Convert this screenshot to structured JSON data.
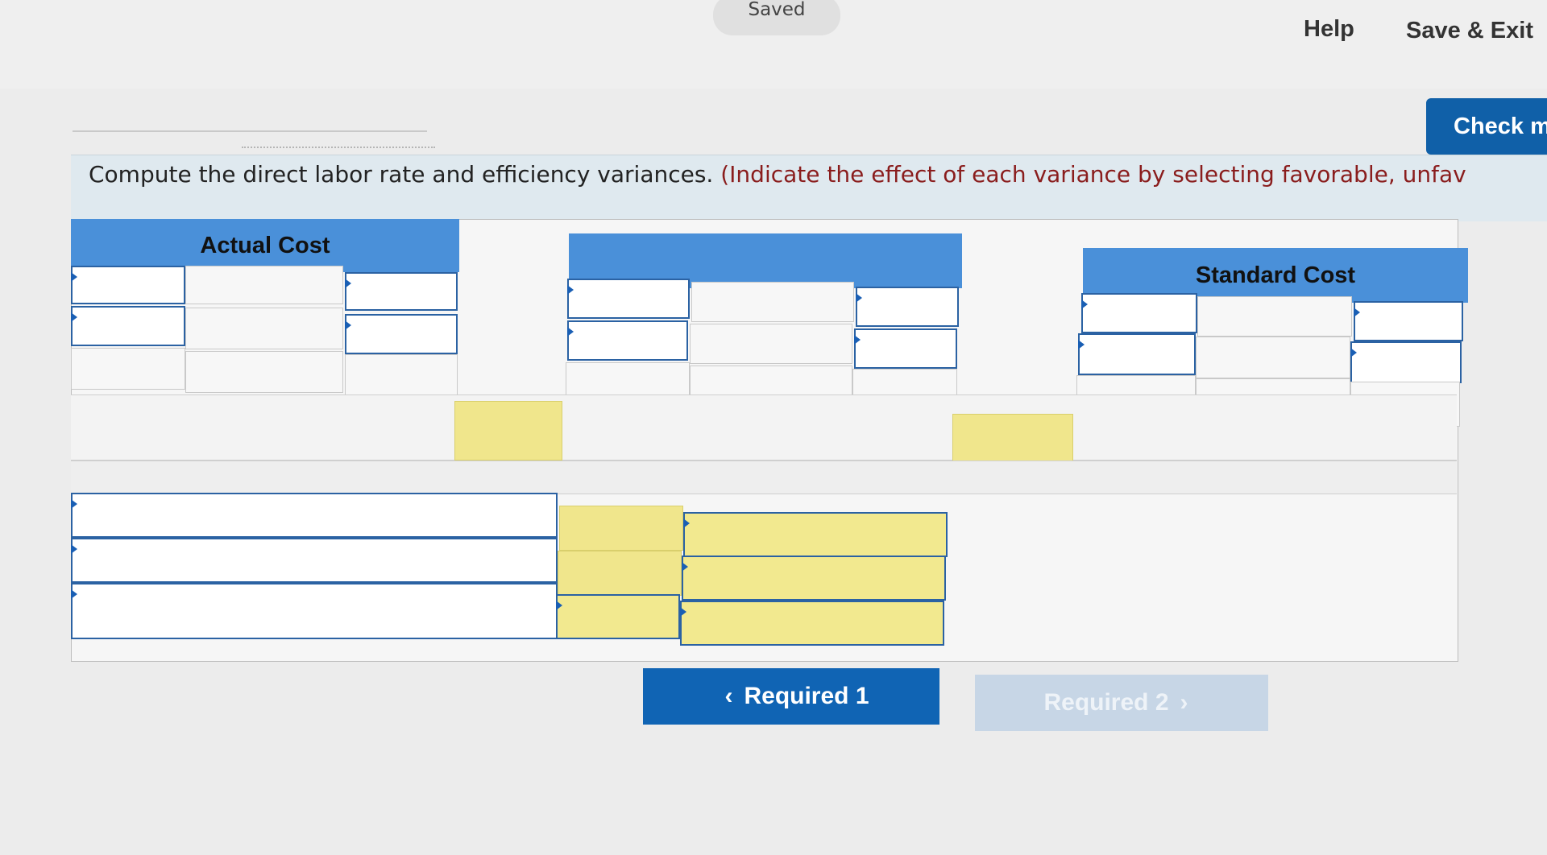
{
  "header": {
    "status": "Saved",
    "help": "Help",
    "save_exit": "Save & Exit",
    "check": "Check m"
  },
  "question": {
    "main": "Compute the direct labor rate and efficiency variances.",
    "paren": "(Indicate the effect of each variance by selecting favorable, unfav"
  },
  "worksheet": {
    "actual_header": "Actual Cost",
    "middle_header": "",
    "standard_header": "Standard Cost"
  },
  "nav": {
    "prev_label": "Required 1",
    "prev_chevron": "‹",
    "next_label": "Required 2",
    "next_chevron": "›"
  },
  "colors": {
    "accent": "#1064b4",
    "header_blue": "#4a90d9",
    "answer_yellow": "#f0e68c"
  }
}
